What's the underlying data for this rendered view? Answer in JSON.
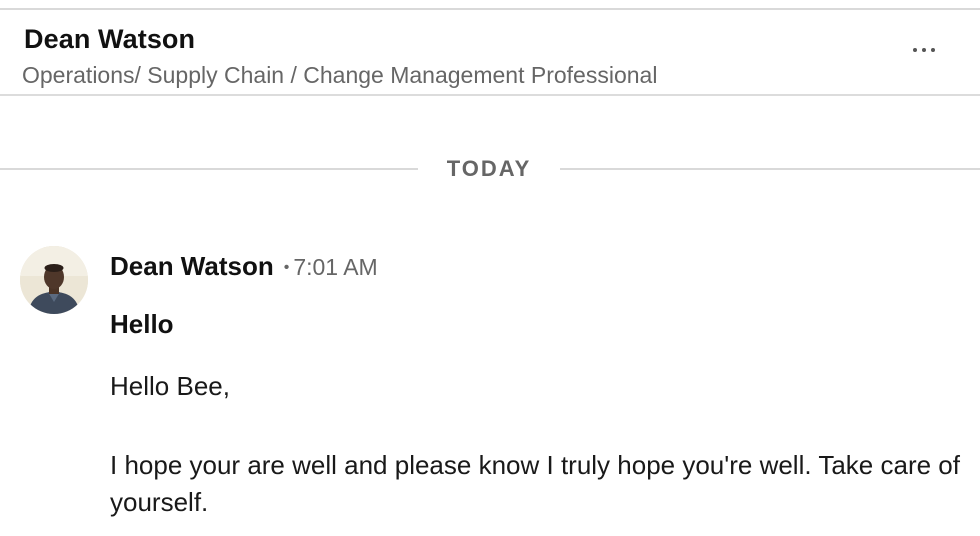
{
  "conversation_header": {
    "name": "Dean Watson",
    "headline": "Operations/ Supply Chain / Change Management Professional",
    "more_icon": "more-horizontal-icon"
  },
  "date_divider": {
    "label": "TODAY"
  },
  "message": {
    "sender": "Dean Watson",
    "separator": "•",
    "time": "7:01 AM",
    "subject": "Hello",
    "greeting": "Hello Bee,",
    "body": "I hope your are well and please know I truly hope you're well. Take care of yourself."
  }
}
